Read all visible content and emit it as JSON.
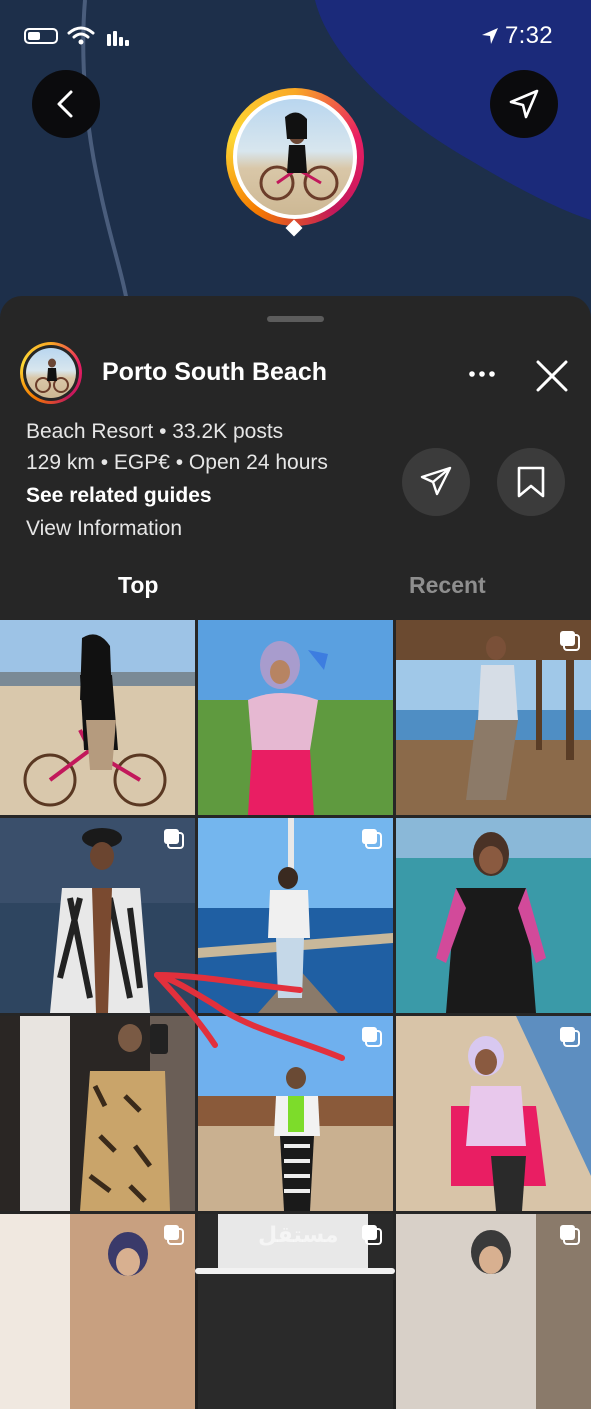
{
  "status_bar": {
    "time": "7:32"
  },
  "map": {
    "back_icon": "chevron-left-icon",
    "navigate_icon": "navigation-arrow-icon"
  },
  "place": {
    "name": "Porto South Beach",
    "category_posts": "Beach Resort • 33.2K posts",
    "distance_hours": "129 km • EGP€ • Open 24 hours",
    "related_guides": "See related guides",
    "view_information": "View Information"
  },
  "tabs": [
    {
      "label": "Top",
      "active": true
    },
    {
      "label": "Recent",
      "active": false
    }
  ],
  "grid": {
    "posts": [
      {
        "scene": "woman-on-bicycle-beach",
        "multi": false
      },
      {
        "scene": "woman-pink-outfit-beach-umbrellas",
        "multi": false
      },
      {
        "scene": "woman-under-pier",
        "multi": true
      },
      {
        "scene": "man-striped-shirt-sea",
        "multi": true
      },
      {
        "scene": "woman-on-jetty",
        "multi": true
      },
      {
        "scene": "woman-hijab-swimsuit-sea",
        "multi": false
      },
      {
        "scene": "woman-mirror-selfie",
        "multi": false
      },
      {
        "scene": "woman-zebra-pants-promenade",
        "multi": true
      },
      {
        "scene": "woman-hijab-pink-beach",
        "multi": true
      },
      {
        "scene": "woman-hallway",
        "multi": true
      },
      {
        "scene": "watermark-post",
        "multi": true
      },
      {
        "scene": "woman-hijab-indoor",
        "multi": true
      }
    ]
  },
  "watermark": "مستقل",
  "colors": {
    "sheet_bg": "#262626",
    "map_bg": "#1d2f4a",
    "sea_blue": "#1a2a78",
    "annotation_red": "#e2303c"
  }
}
